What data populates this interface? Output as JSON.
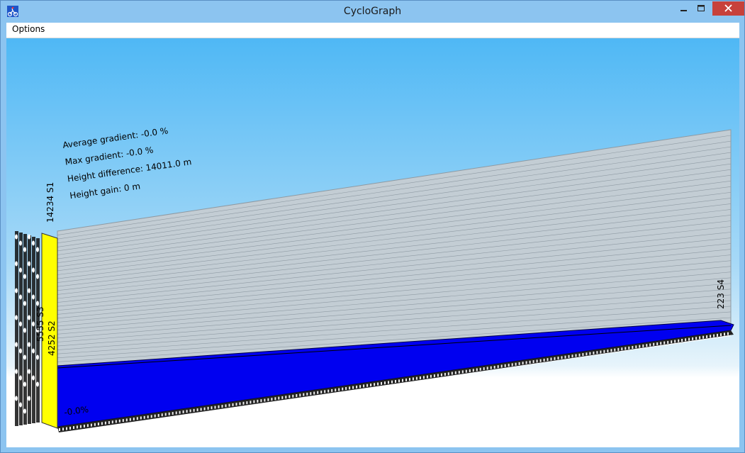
{
  "window": {
    "title": "CycloGraph",
    "controls": {
      "minimize": "minimize-icon",
      "maximize": "maximize-icon",
      "close": "close-icon"
    }
  },
  "menu": {
    "options_label": "Options"
  },
  "stats": {
    "average_gradient": "Average gradient: -0.0 %",
    "max_gradient": "Max gradient: -0.0 %",
    "height_difference": "Height difference: 14011.0 m",
    "height_gain": "Height gain: 0 m"
  },
  "profile_labels": {
    "s1": "14234 S1",
    "s3": "5555 S3",
    "s2": "4252 S2",
    "s4": "223 S4",
    "segment_gradient": "-0.0%"
  },
  "colors": {
    "sky_top": "#4fb8f5",
    "sky_bottom": "#dff1fb",
    "wall": "#c3cdd4",
    "wall_line": "#8e9aa3",
    "profile_fill": "#0000f0",
    "side_fill": "#ffff00",
    "close_button": "#c7413b"
  }
}
